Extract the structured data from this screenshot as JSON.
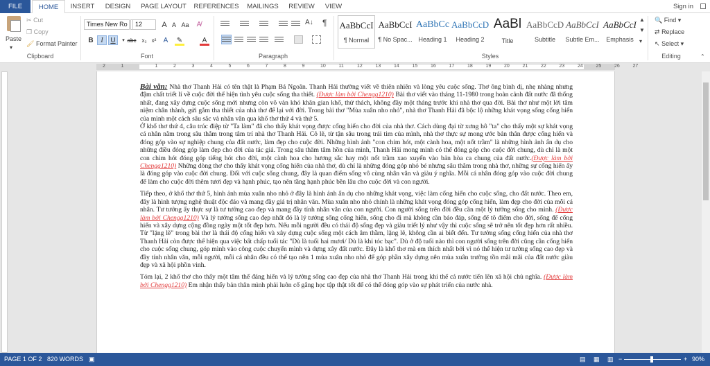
{
  "tabs": [
    "FILE",
    "HOME",
    "INSERT",
    "DESIGN",
    "PAGE LAYOUT",
    "REFERENCES",
    "MAILINGS",
    "REVIEW",
    "VIEW"
  ],
  "signin": "Sign in",
  "clipboard": {
    "paste": "Paste",
    "cut": "Cut",
    "copy": "Copy",
    "format_painter": "Format Painter",
    "label": "Clipboard"
  },
  "font": {
    "name": "Times New Ro",
    "size": "12",
    "label": "Font",
    "bold": "B",
    "italic": "I",
    "underline": "U",
    "strike": "abc",
    "sub": "x₂",
    "sup": "x²",
    "grow": "A",
    "shrink": "A",
    "case": "Aa"
  },
  "paragraph": {
    "label": "Paragraph",
    "pilcrow": "¶"
  },
  "styles": {
    "label": "Styles",
    "items": [
      {
        "preview": "AaBbCcI",
        "name": "¶ Normal"
      },
      {
        "preview": "AaBbCcI",
        "name": "¶ No Spac..."
      },
      {
        "preview": "AaBbCc",
        "name": "Heading 1"
      },
      {
        "preview": "AaBbCcD",
        "name": "Heading 2"
      },
      {
        "preview": "AaBl",
        "name": "Title"
      },
      {
        "preview": "AaBbCcD",
        "name": "Subtitle"
      },
      {
        "preview": "AaBbCcI",
        "name": "Subtle Em..."
      },
      {
        "preview": "AaBbCcI",
        "name": "Emphasis"
      }
    ]
  },
  "editing": {
    "label": "Editing",
    "find": "Find",
    "replace": "Replace",
    "select": "Select"
  },
  "ruler_nums": [
    "2",
    "1",
    "1",
    "2",
    "3",
    "4",
    "5",
    "6",
    "7",
    "8",
    "9",
    "10",
    "11",
    "12",
    "13",
    "14",
    "15",
    "16",
    "17",
    "18",
    "19",
    "20",
    "21",
    "22",
    "23",
    "24",
    "25",
    "26",
    "27"
  ],
  "doc": {
    "p1_head": "Bài văn:",
    "p1_a": " Nhà thơ Thanh Hải có tên thật là Phạm Bá Ngoãn. Thanh Hải thường viết về thiên nhiên và lòng yêu cuộc sống. Thơ ông bình dị, nhẹ nhàng nhưng đậm chất triết lí về cuộc đời thể hiện tình yêu cuộc sống tha thiết. ",
    "p1_red": "(Được làm bởi Chengg1210)",
    "p1_b": "  Bài thơ viết vào tháng 11-1980 trong hoàn cảnh đất nước đã thống nhất, đang xây dựng cuộc sống mới nhưng còn vô vàn khó khăn gian khổ, thử thách, không đầy một tháng trước khi nhà thơ qua đời. Bài thơ như một lời tâm niệm chân thành, gửi gắm tha thiết của nhà thơ để lại với đời. Trong bài thơ \"Mùa xuân nho nhỏ\", nhà thơ Thanh Hải đã bộc lộ những khát vọng sống cống hiến của mình một cách sâu sắc và nhân văn qua khổ thơ thứ 4 và thứ 5.",
    "p2_a": "Ở khổ thơ thứ 4, câu trúc điệp từ \"Ta làm\" đã cho thấy khát vọng được cống hiến cho đời của nhà thơ. Cách dùng đại từ xưng hô \"ta\" cho thấy một sự khát vọng cá nhân nằm trong sâu thẳm trong tâm trí nhà thơ Thanh Hải. Cõ lẽ, từ tận sâu trong trái tim của mình, nhà thơ thực sự mong ước bản thân được cống hiến và đóng góp vào sự nghiệp chung của đất nước, làm đẹp cho cuộc đời. Những hình ảnh \"con chim hót, một cành hoa, một nốt trầm\" là những hình ảnh ẩn dụ cho những điều đóng góp làm đẹp cho đời của tác giả. Trong sâu thăm tâm hồn của mình, Thanh Hải mong mình có thể đóng góp cho cuộc đời chung, dù chỉ là một con chim hót đóng góp tiếng hót cho đời, một cành hoa cho hương sắc hay một nốt trầm xao xuyến vào bản hòa ca chung của đất nước.",
    "p2_red": "(Được làm bởi Chengg1210)",
    "p2_b": " Những dòng thơ cho thấy khát vọng cống hiến của nhà thơ, dù chỉ là những đóng góp nhỏ bé nhưng sâu thẳm trong nhà thơ, những sự cống hiến ấy là đóng góp vào cuộc đời chung. Đối với cuộc sống chung, đây là quan điểm sống vô cùng nhân văn và giàu ý nghĩa. Mỗi cá nhân đóng góp vào cuộc đời chung để làm cho cuộc đời thêm tươi đẹp và hạnh phúc, tạo nên tầng hạnh phúc bền lâu cho cuộc đời và con người.",
    "p3_a": "Tiếp theo, ở khổ thơ thứ 5, hình ảnh mùa xuân nho nhỏ ở đây là hình ảnh ẩn dụ cho những khát vọng, việc làm cống hiến cho cuộc sống, cho đất nước. Theo em, đây là hình tượng nghệ thuật độc đáo và mang đầy giá trị nhân văn. Mùa xuân nho nhỏ chính là những khát vọng đóng góp cống hiến, làm đẹp cho đời của mỗi cá nhân. Tư tưởng ấy thực sự là tư tưởng cao đẹp và mang đầy tính nhân văn của con người. Con người sống trên đời đều cần một lý tưởng sống cho mình. ",
    "p3_red": "(Được làm bởi Chengg1210)",
    "p3_b": " Và lý tưởng sống cao đẹp nhất đó là lý tưởng sống cống hiến, sống cho đi mà không cần báo đáp, sống để tô điểm cho đời, sống để cống hiến và xây dựng cộng đồng ngày một tốt đẹp hơn. Nếu mỗi người đều có thái độ sống đẹp và giàu triết lý như vậy thì cuộc sống sẽ trở nên tốt đẹp hơn rất nhiều. Từ \"lặng lẽ\" trong bài thơ là thái độ cống hiến và xây dựng cuộc sống một cách âm thầm, lặng lẽ, không cần ai biết đến. Tư tưởng sống cống hiến của nhà thơ Thanh Hải còn được thể hiện qua việc bất chấp tuổi tác \"Dù là tuổi hai mươi/ Dù là khi tóc bạc\". Dù ở độ tuổi nào thì con người sống trên đời cũng cần cống hiến cho cuộc sống chung, góp mình vào công cuộc chuyển mình và dựng xây đất nước. Đây là khổ thơ mà em thích nhất bởi vì nó thể hiện tư tưởng sống cao đẹp và đầy tính nhân văn, mỗi người, mỗi cá nhân đều có thể tạo nên 1 mùa xuân nho nhỏ để góp phần xây dựng nên mùa xuân trường tồn mãi mãi của đất nước giàu đẹp và xã hội phồn vinh.",
    "p4_a": "Tóm lại, 2 khổ thơ cho thấy một tâm thế đáng hiến và lý tưởng sống cao đẹp của nhà thơ Thanh Hải trong khi thể cả nước tiến lên xã hội chủ nghĩa. ",
    "p4_red": "(Được làm bởi Chengg1210)",
    "p4_b": "  Em nhận thấy bản thân mình phải luôn cố gắng học tập thật tốt để có thể đóng góp vào sự phát triển của nước nhà."
  },
  "status": {
    "page": "PAGE 1 OF 2",
    "words": "820 WORDS",
    "zoom": "90%"
  }
}
